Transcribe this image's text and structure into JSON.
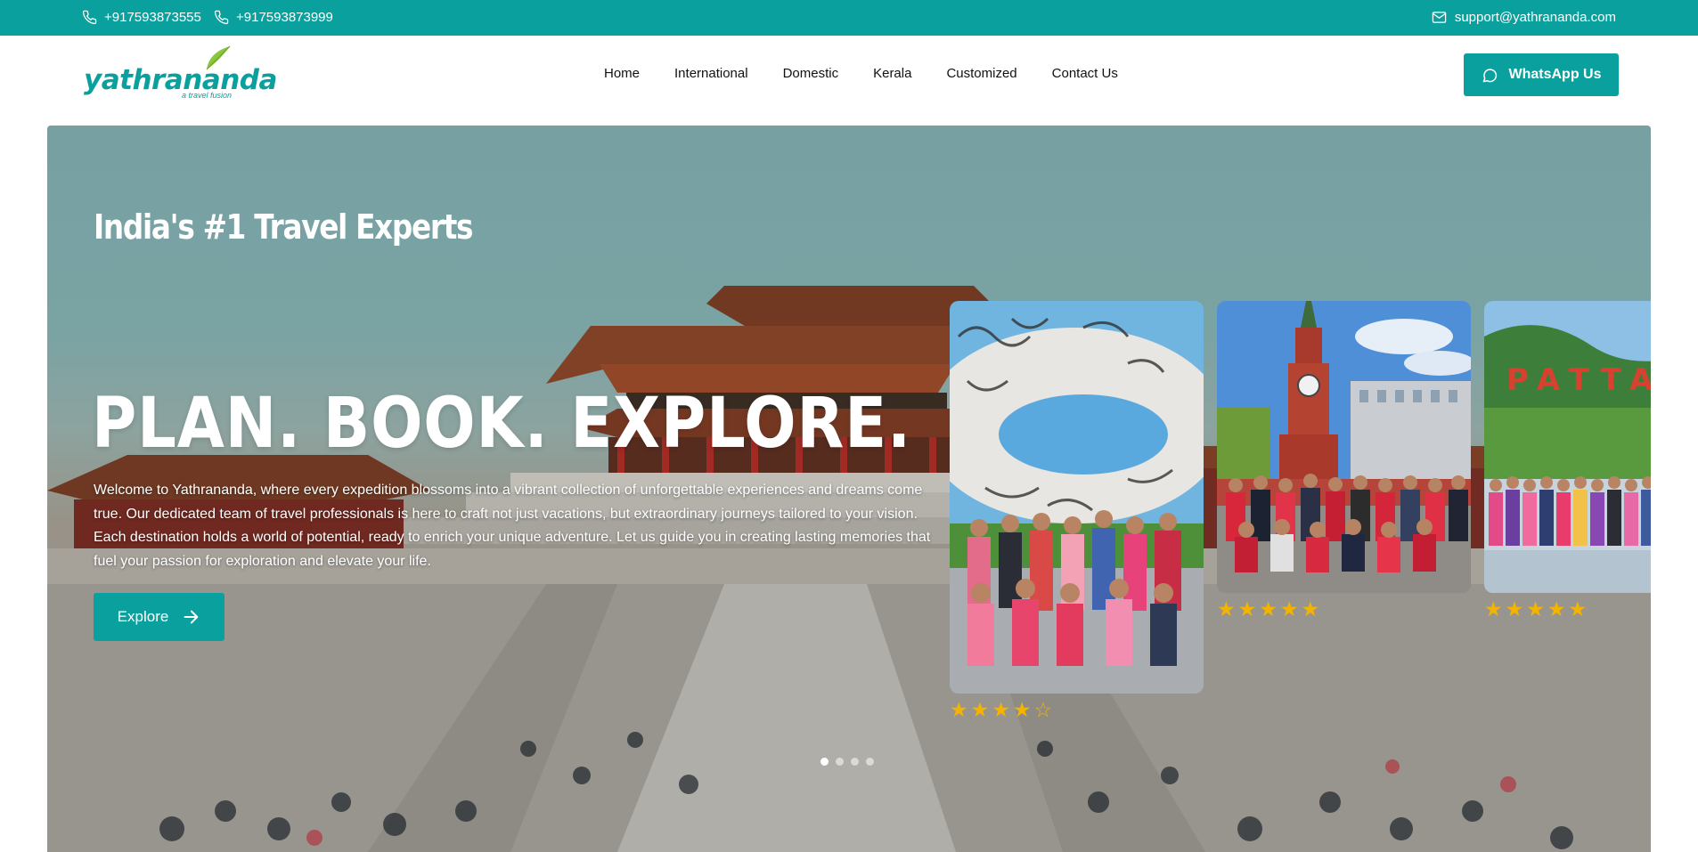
{
  "topbar": {
    "phone_1": "+917593873555",
    "phone_2": "+917593873999",
    "email": "support@yathrananda.com"
  },
  "header": {
    "logo_text": "yathrananda",
    "logo_subtext": "a travel fusion",
    "nav": [
      "Home",
      "International",
      "Domestic",
      "Kerala",
      "Customized",
      "Contact Us"
    ],
    "cta_label": "WhatsApp Us"
  },
  "hero": {
    "tagline": "India's #1 Travel Experts",
    "headline": "PLAN. BOOK. EXPLORE.",
    "intro": "Welcome to Yathrananda, where every expedition blossoms into a vibrant collection of unforgettable experiences and dreams come true. Our dedicated team of travel professionals is here to craft not just vacations, but extraordinary journeys tailored to your vision. Each destination holds a world of potential, ready to enrich your unique adventure. Let us guide you in creating lasting memories that fuel your passion for exploration and elevate your life.",
    "explore_label": "Explore",
    "carousel_dots": 4,
    "active_dot": 0
  },
  "cards": [
    {
      "destination": "Museum of the Future group tour",
      "rating": 4
    },
    {
      "destination": "Kremlin tower group tour",
      "rating": 5
    },
    {
      "destination": "Pattaya group tour",
      "rating": 5,
      "sign_text": "PATTA"
    }
  ],
  "colors": {
    "brand": "#0aa09d",
    "star": "#f5b301",
    "white": "#ffffff"
  },
  "icons": {
    "phone": "phone-icon",
    "email": "mail-icon",
    "whatsapp": "chat-bubble-icon",
    "arrow": "arrow-right-icon",
    "star": "star-icon"
  }
}
